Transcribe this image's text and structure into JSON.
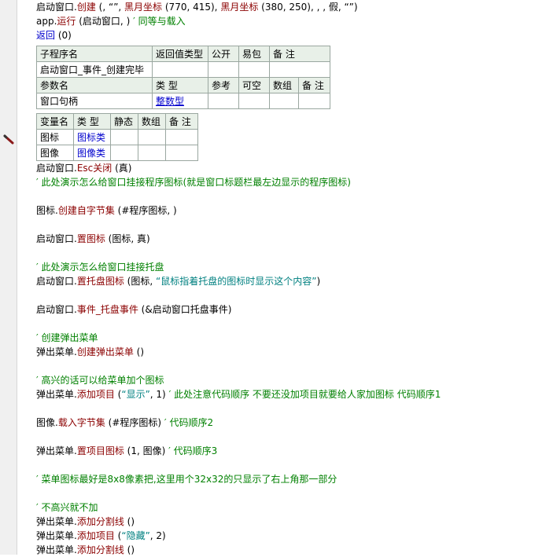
{
  "top_lines": [
    {
      "segs": [
        {
          "t": "启动窗口",
          "c": "b"
        },
        {
          "t": ".",
          "c": "b"
        },
        {
          "t": "创建",
          "c": "m"
        },
        {
          "t": " (, “”, ",
          "c": "b"
        },
        {
          "t": "黑月坐标",
          "c": "m"
        },
        {
          "t": " (770, 415), ",
          "c": "b"
        },
        {
          "t": "黑月坐标",
          "c": "m"
        },
        {
          "t": " (380, 250), , , 假, “”)",
          "c": "b"
        }
      ]
    },
    {
      "segs": [
        {
          "t": "app",
          "c": "b"
        },
        {
          "t": ".",
          "c": "b"
        },
        {
          "t": "运行",
          "c": "m"
        },
        {
          "t": " (启动窗口, ) ",
          "c": "b"
        },
        {
          "t": "′ 同等与载入",
          "c": "g"
        }
      ]
    },
    {
      "segs": [
        {
          "t": "返回",
          "c": "bl"
        },
        {
          "t": " (0)",
          "c": "b"
        }
      ]
    }
  ],
  "sub_table": {
    "header": [
      "子程序名",
      "返回值类型",
      "公开",
      "易包",
      "备 注"
    ],
    "row": [
      "启动窗口_事件_创建完毕",
      "",
      "",
      "",
      ""
    ],
    "param_header": [
      "参数名",
      "类 型",
      "参考",
      "可空",
      "数组",
      "备 注"
    ],
    "param_row": [
      "窗口句柄",
      "整数型",
      "",
      "",
      "",
      ""
    ]
  },
  "var_table": {
    "header": [
      "变量名",
      "类 型",
      "静态",
      "数组",
      "备 注"
    ],
    "rows": [
      [
        "图标",
        "图标类",
        "",
        "",
        ""
      ],
      [
        "图像",
        "图像类",
        "",
        "",
        ""
      ]
    ]
  },
  "body_lines": [
    {
      "segs": [
        {
          "t": "启动窗口",
          "c": "b"
        },
        {
          "t": ".",
          "c": "b"
        },
        {
          "t": "Esc关闭",
          "c": "m"
        },
        {
          "t": " (真)",
          "c": "b"
        }
      ]
    },
    {
      "segs": [
        {
          "t": "′ 此处演示怎么给窗口挂接程序图标(就是窗口标题栏最左边显示的程序图标)",
          "c": "g"
        }
      ]
    },
    {
      "blank": true
    },
    {
      "segs": [
        {
          "t": "图标",
          "c": "b"
        },
        {
          "t": ".",
          "c": "b"
        },
        {
          "t": "创建自字节集",
          "c": "m"
        },
        {
          "t": " (#程序图标, )",
          "c": "b"
        }
      ]
    },
    {
      "blank": true
    },
    {
      "segs": [
        {
          "t": "启动窗口",
          "c": "b"
        },
        {
          "t": ".",
          "c": "b"
        },
        {
          "t": "置图标",
          "c": "m"
        },
        {
          "t": " (图标, 真)",
          "c": "b"
        }
      ]
    },
    {
      "blank": true
    },
    {
      "segs": [
        {
          "t": "′ 此处演示怎么给窗口挂接托盘",
          "c": "g"
        }
      ]
    },
    {
      "segs": [
        {
          "t": "启动窗口",
          "c": "b"
        },
        {
          "t": ".",
          "c": "b"
        },
        {
          "t": "置托盘图标",
          "c": "m"
        },
        {
          "t": " (图标, ",
          "c": "b"
        },
        {
          "t": "“鼠标指着托盘的图标时显示这个内容”",
          "c": "str"
        },
        {
          "t": ")",
          "c": "b"
        }
      ]
    },
    {
      "blank": true
    },
    {
      "segs": [
        {
          "t": "启动窗口",
          "c": "b"
        },
        {
          "t": ".",
          "c": "b"
        },
        {
          "t": "事件_托盘事件",
          "c": "m"
        },
        {
          "t": " (&启动窗口托盘事件)",
          "c": "b"
        }
      ]
    },
    {
      "blank": true
    },
    {
      "segs": [
        {
          "t": "′ 创建弹出菜单",
          "c": "g"
        }
      ]
    },
    {
      "segs": [
        {
          "t": "弹出菜单",
          "c": "b"
        },
        {
          "t": ".",
          "c": "b"
        },
        {
          "t": "创建弹出菜单",
          "c": "m"
        },
        {
          "t": " ()",
          "c": "b"
        }
      ]
    },
    {
      "blank": true
    },
    {
      "segs": [
        {
          "t": "′ 高兴的话可以给菜单加个图标",
          "c": "g"
        }
      ]
    },
    {
      "segs": [
        {
          "t": "弹出菜单",
          "c": "b"
        },
        {
          "t": ".",
          "c": "b"
        },
        {
          "t": "添加项目",
          "c": "m"
        },
        {
          "t": " (",
          "c": "b"
        },
        {
          "t": "“显示”",
          "c": "str"
        },
        {
          "t": ", 1) ",
          "c": "b"
        },
        {
          "t": "′ 此处注意代码顺序 不要还没加项目就要给人家加图标 代码顺序1",
          "c": "g"
        }
      ]
    },
    {
      "blank": true
    },
    {
      "segs": [
        {
          "t": "图像",
          "c": "b"
        },
        {
          "t": ".",
          "c": "b"
        },
        {
          "t": "载入字节集",
          "c": "m"
        },
        {
          "t": " (#程序图标) ",
          "c": "b"
        },
        {
          "t": "′ 代码顺序2",
          "c": "g"
        }
      ]
    },
    {
      "blank": true
    },
    {
      "segs": [
        {
          "t": "弹出菜单",
          "c": "b"
        },
        {
          "t": ".",
          "c": "b"
        },
        {
          "t": "置项目图标",
          "c": "m"
        },
        {
          "t": " (1, 图像) ",
          "c": "b"
        },
        {
          "t": "′ 代码顺序3",
          "c": "g"
        }
      ]
    },
    {
      "blank": true
    },
    {
      "segs": [
        {
          "t": "′ 菜单图标最好是8x8像素把,这里用个32x32的只显示了右上角那一部分",
          "c": "g"
        }
      ]
    },
    {
      "blank": true
    },
    {
      "segs": [
        {
          "t": "′ 不高兴就不加",
          "c": "g"
        }
      ]
    },
    {
      "segs": [
        {
          "t": "弹出菜单",
          "c": "b"
        },
        {
          "t": ".",
          "c": "b"
        },
        {
          "t": "添加分割线",
          "c": "m"
        },
        {
          "t": " ()",
          "c": "b"
        }
      ]
    },
    {
      "segs": [
        {
          "t": "弹出菜单",
          "c": "b"
        },
        {
          "t": ".",
          "c": "b"
        },
        {
          "t": "添加项目",
          "c": "m"
        },
        {
          "t": " (",
          "c": "b"
        },
        {
          "t": "“隐藏”",
          "c": "str"
        },
        {
          "t": ", 2)",
          "c": "b"
        }
      ]
    },
    {
      "segs": [
        {
          "t": "弹出菜单",
          "c": "b"
        },
        {
          "t": ".",
          "c": "b"
        },
        {
          "t": "添加分割线",
          "c": "m"
        },
        {
          "t": " ()",
          "c": "b"
        }
      ]
    }
  ],
  "colors": {
    "b": "#000000",
    "m": "#8b0000",
    "g": "#008000",
    "bl": "#0000cd",
    "str": "#008080"
  },
  "icons": {
    "gutter_marker": "breakpoint-pencil-icon"
  }
}
